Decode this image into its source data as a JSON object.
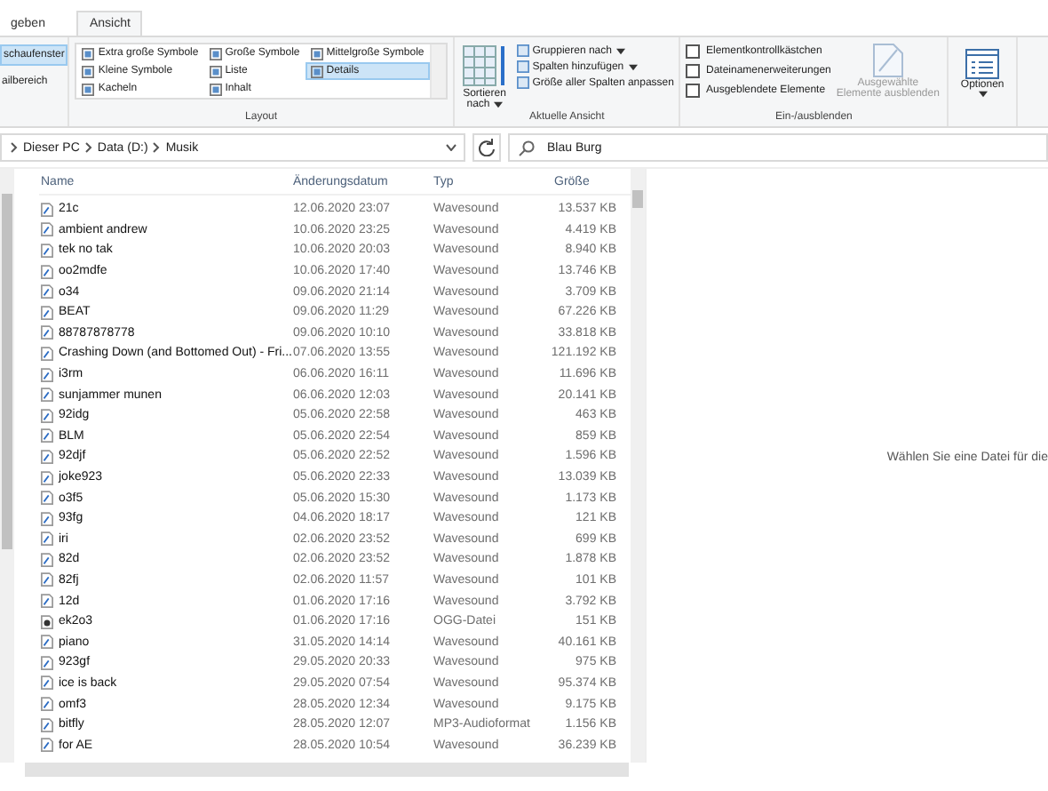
{
  "tabs": [
    {
      "label": "geben",
      "selected": false
    },
    {
      "label": "Ansicht",
      "selected": true
    }
  ],
  "ribbon": {
    "panes": [
      {
        "label": "schaufenster",
        "selected": true
      },
      {
        "label": "ailbereich",
        "selected": false
      }
    ],
    "layout": {
      "label": "Layout",
      "items": [
        {
          "label": "Extra große Symbole",
          "selected": false
        },
        {
          "label": "Große Symbole",
          "selected": false
        },
        {
          "label": "Mittelgroße Symbole",
          "selected": false
        },
        {
          "label": "Kleine Symbole",
          "selected": false
        },
        {
          "label": "Liste",
          "selected": false
        },
        {
          "label": "Details",
          "selected": true
        },
        {
          "label": "Kacheln",
          "selected": false
        },
        {
          "label": "Inhalt",
          "selected": false
        }
      ]
    },
    "current_view": {
      "label": "Aktuelle Ansicht",
      "sort": {
        "label": "Sortieren",
        "label2": "nach",
        "dropdown": true
      },
      "items": [
        {
          "label": "Gruppieren nach",
          "dropdown": true
        },
        {
          "label": "Spalten hinzufügen",
          "dropdown": true
        },
        {
          "label": "Größe aller Spalten anpassen",
          "dropdown": false
        }
      ]
    },
    "show_hide": {
      "label": "Ein-/ausblenden",
      "checkboxes": [
        {
          "label": "Elementkontrollkästchen",
          "checked": false
        },
        {
          "label": "Dateinamenerweiterungen",
          "checked": false
        },
        {
          "label": "Ausgeblendete Elemente",
          "checked": false
        }
      ],
      "hide_selected": {
        "label": "Ausgewählte",
        "label2": "Elemente ausblenden",
        "disabled": true
      }
    },
    "options": {
      "label": "Optionen",
      "dropdown": true
    }
  },
  "address": {
    "path": [
      "Dieser PC",
      "Data (D:)",
      "Musik"
    ]
  },
  "search": {
    "value": "Blau Burg"
  },
  "table": {
    "columns": [
      "Name",
      "Änderungsdatum",
      "Typ",
      "Größe"
    ],
    "rows": [
      {
        "name": "21c",
        "date": "12.06.2020 23:07",
        "type": "Wavesound",
        "size": "13.537 KB",
        "kind": "wave"
      },
      {
        "name": "ambient andrew",
        "date": "10.06.2020 23:25",
        "type": "Wavesound",
        "size": "4.419 KB",
        "kind": "wave"
      },
      {
        "name": "tek no tak",
        "date": "10.06.2020 20:03",
        "type": "Wavesound",
        "size": "8.940 KB",
        "kind": "wave"
      },
      {
        "name": "oo2mdfe",
        "date": "10.06.2020 17:40",
        "type": "Wavesound",
        "size": "13.746 KB",
        "kind": "wave"
      },
      {
        "name": "o34",
        "date": "09.06.2020 21:14",
        "type": "Wavesound",
        "size": "3.709 KB",
        "kind": "wave"
      },
      {
        "name": "BEAT",
        "date": "09.06.2020 11:29",
        "type": "Wavesound",
        "size": "67.226 KB",
        "kind": "wave"
      },
      {
        "name": "88787878778",
        "date": "09.06.2020 10:10",
        "type": "Wavesound",
        "size": "33.818 KB",
        "kind": "wave"
      },
      {
        "name": "Crashing Down (and Bottomed Out) - Fri...",
        "date": "07.06.2020 13:55",
        "type": "Wavesound",
        "size": "121.192 KB",
        "kind": "wave"
      },
      {
        "name": "i3rm",
        "date": "06.06.2020 16:11",
        "type": "Wavesound",
        "size": "11.696 KB",
        "kind": "wave"
      },
      {
        "name": "sunjammer munen",
        "date": "06.06.2020 12:03",
        "type": "Wavesound",
        "size": "20.141 KB",
        "kind": "wave"
      },
      {
        "name": "92idg",
        "date": "05.06.2020 22:58",
        "type": "Wavesound",
        "size": "463 KB",
        "kind": "wave"
      },
      {
        "name": "BLM",
        "date": "05.06.2020 22:54",
        "type": "Wavesound",
        "size": "859 KB",
        "kind": "wave"
      },
      {
        "name": "92djf",
        "date": "05.06.2020 22:52",
        "type": "Wavesound",
        "size": "1.596 KB",
        "kind": "wave"
      },
      {
        "name": "joke923",
        "date": "05.06.2020 22:33",
        "type": "Wavesound",
        "size": "13.039 KB",
        "kind": "wave"
      },
      {
        "name": "o3f5",
        "date": "05.06.2020 15:30",
        "type": "Wavesound",
        "size": "1.173 KB",
        "kind": "wave"
      },
      {
        "name": "93fg",
        "date": "04.06.2020 18:17",
        "type": "Wavesound",
        "size": "121 KB",
        "kind": "wave"
      },
      {
        "name": "iri",
        "date": "02.06.2020 23:52",
        "type": "Wavesound",
        "size": "699 KB",
        "kind": "wave"
      },
      {
        "name": "82d",
        "date": "02.06.2020 23:52",
        "type": "Wavesound",
        "size": "1.878 KB",
        "kind": "wave"
      },
      {
        "name": "82fj",
        "date": "02.06.2020 11:57",
        "type": "Wavesound",
        "size": "101 KB",
        "kind": "wave"
      },
      {
        "name": "12d",
        "date": "01.06.2020 17:16",
        "type": "Wavesound",
        "size": "3.792 KB",
        "kind": "wave"
      },
      {
        "name": "ek2o3",
        "date": "01.06.2020 17:16",
        "type": "OGG-Datei",
        "size": "151 KB",
        "kind": "ogg"
      },
      {
        "name": "piano",
        "date": "31.05.2020 14:14",
        "type": "Wavesound",
        "size": "40.161 KB",
        "kind": "wave"
      },
      {
        "name": "923gf",
        "date": "29.05.2020 20:33",
        "type": "Wavesound",
        "size": "975 KB",
        "kind": "wave"
      },
      {
        "name": "ice is back",
        "date": "29.05.2020 07:54",
        "type": "Wavesound",
        "size": "95.374 KB",
        "kind": "wave"
      },
      {
        "name": "omf3",
        "date": "28.05.2020 12:34",
        "type": "Wavesound",
        "size": "9.175 KB",
        "kind": "wave"
      },
      {
        "name": "bitfly",
        "date": "28.05.2020 12:07",
        "type": "MP3-Audioformat",
        "size": "1.156 KB",
        "kind": "wave"
      },
      {
        "name": "for AE",
        "date": "28.05.2020 10:54",
        "type": "Wavesound",
        "size": "36.239 KB",
        "kind": "wave"
      }
    ]
  },
  "preview": {
    "message": "Wählen Sie eine Datei für die"
  }
}
